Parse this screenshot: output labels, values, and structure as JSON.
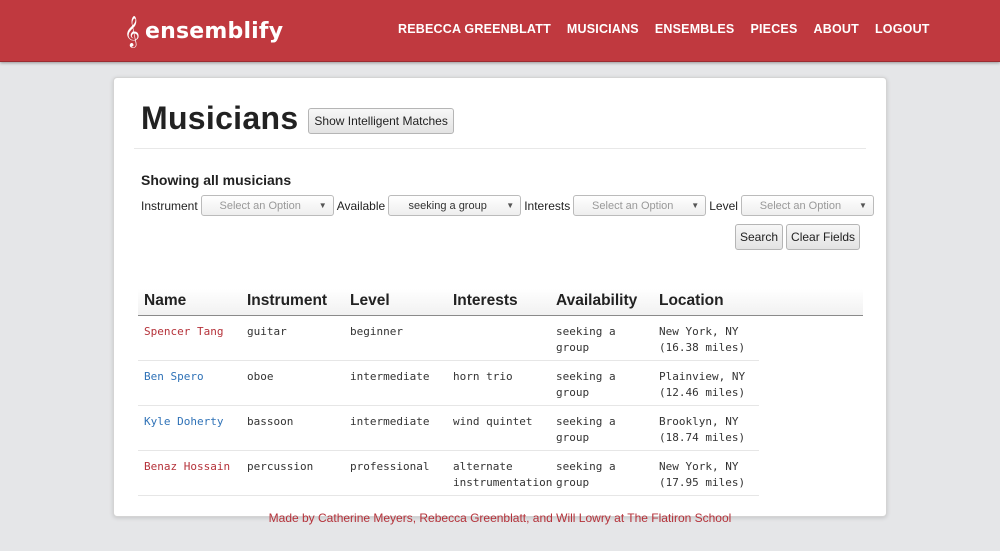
{
  "brand": {
    "icon": "treble-clef-icon",
    "icon_glyph": "𝄞",
    "name": "ensemblify"
  },
  "nav": [
    {
      "label": "REBECCA GREENBLATT"
    },
    {
      "label": "MUSICIANS"
    },
    {
      "label": "ENSEMBLES"
    },
    {
      "label": "PIECES"
    },
    {
      "label": "ABOUT"
    },
    {
      "label": "LOGOUT"
    }
  ],
  "page": {
    "title": "Musicians",
    "matches_button": "Show Intelligent Matches",
    "subhead": "Showing all musicians"
  },
  "filters": {
    "instrument": {
      "label": "Instrument",
      "value": "Select an Option"
    },
    "available": {
      "label": "Available",
      "value": "seeking a group"
    },
    "interests": {
      "label": "Interests",
      "value": "Select an Option"
    },
    "level": {
      "label": "Level",
      "value": "Select an Option"
    },
    "search_button": "Search",
    "clear_button": "Clear Fields"
  },
  "table": {
    "headers": [
      "Name",
      "Instrument",
      "Level",
      "Interests",
      "Availability",
      "Location"
    ],
    "rows": [
      {
        "name": "Spencer Tang",
        "instrument": "guitar",
        "level": "beginner",
        "interests": "",
        "availability": "seeking a group",
        "location": "New York, NY",
        "distance": "(16.38 miles)"
      },
      {
        "name": "Ben Spero",
        "instrument": "oboe",
        "level": "intermediate",
        "interests": "horn trio",
        "availability": "seeking a group",
        "location": "Plainview, NY",
        "distance": "(12.46 miles)"
      },
      {
        "name": "Kyle Doherty",
        "instrument": "bassoon",
        "level": "intermediate",
        "interests": "wind quintet",
        "availability": "seeking a group",
        "location": "Brooklyn, NY",
        "distance": "(18.74 miles)"
      },
      {
        "name": "Benaz Hossain",
        "instrument": "percussion",
        "level": "professional",
        "interests": "alternate instrumentation",
        "availability": "seeking a group",
        "location": "New York, NY",
        "distance": "(17.95 miles)"
      }
    ]
  },
  "colors": {
    "header": "#c0393f",
    "link_red": "#b5323a",
    "link_blue": "#2f72b7",
    "background": "#e5e6e8"
  },
  "footer": "Made by Catherine Meyers, Rebecca Greenblatt, and Will Lowry at The Flatiron School"
}
